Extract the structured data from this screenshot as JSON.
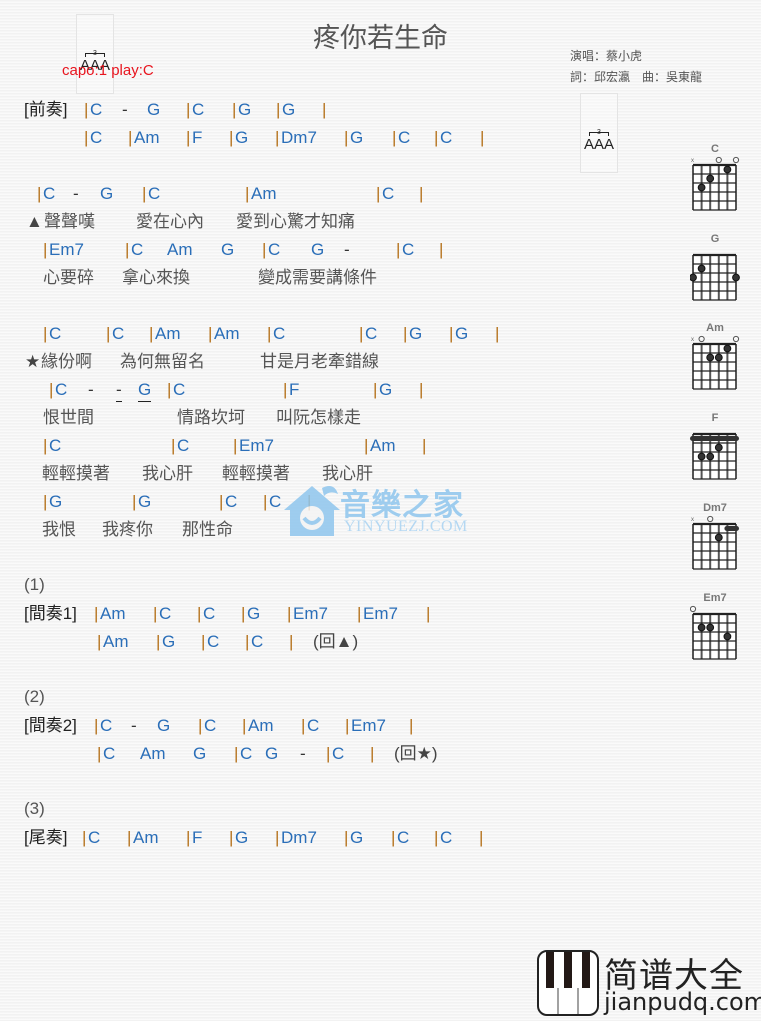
{
  "title": "疼你若生命",
  "triplet_icon": {
    "number": "3",
    "notes": "AAA"
  },
  "capo": "capo:1 play:C",
  "credits": {
    "singer": "演唱：蔡小虎",
    "lyricist_composer": "詞：邱宏瀛　曲：吳東龍"
  },
  "sections": {
    "intro_label": "[前奏]",
    "interlude1_label": "[間奏1]",
    "interlude2_label": "[間奏2]",
    "outro_label": "[尾奏]",
    "part1": "(1)",
    "part2": "(2)",
    "part3": "(3)"
  },
  "lines": {
    "intro_1": [
      "C",
      "-",
      "G",
      "C",
      "G",
      "G"
    ],
    "intro_2": [
      "C",
      "Am",
      "F",
      "G",
      "Dm7",
      "G",
      "C",
      "C"
    ],
    "v1_chords": [
      "C",
      "-",
      "G",
      "C",
      "Am",
      "C"
    ],
    "v1_lyric": {
      "mark": "▲",
      "parts": [
        "聲聲嘆",
        "愛在心內",
        "愛到心驚才知痛"
      ]
    },
    "v2_chords": [
      "Em7",
      "C",
      "Am",
      "G",
      "C",
      "G",
      "-",
      "C"
    ],
    "v2_lyric": {
      "parts": [
        "心要碎",
        "拿心來換",
        "變成需要講條件"
      ]
    },
    "c1_chords": [
      "C",
      "C",
      "Am",
      "Am",
      "C",
      "C",
      "G",
      "G"
    ],
    "c1_lyric": {
      "mark": "★",
      "parts": [
        "緣份啊",
        "為何無留名",
        "甘是月老牽錯線"
      ]
    },
    "c2_chords": [
      "C",
      "-",
      "-",
      "G",
      "C",
      "F",
      "G"
    ],
    "c2_lyric": {
      "parts": [
        "恨世間",
        "情路坎坷",
        "叫阮怎樣走"
      ]
    },
    "c3_chords": [
      "C",
      "C",
      "Em7",
      "Am"
    ],
    "c3_lyric": {
      "parts": [
        "輕輕摸著",
        "我心肝",
        "輕輕摸著",
        "我心肝"
      ]
    },
    "c4_chords": [
      "G",
      "G",
      "C",
      "C"
    ],
    "c4_lyric": {
      "parts": [
        "我恨",
        "我疼你",
        "那性命"
      ]
    },
    "i1_1": [
      "Am",
      "C",
      "C",
      "G",
      "Em7",
      "Em7"
    ],
    "i1_2": [
      "Am",
      "G",
      "C",
      "C"
    ],
    "i1_return": "(回▲)",
    "i2_1": [
      "C",
      "-",
      "G",
      "C",
      "Am",
      "C",
      "Em7"
    ],
    "i2_2": [
      "C",
      "Am",
      "G",
      "C",
      "G",
      "-",
      "C"
    ],
    "i2_return": "(回★)",
    "outro": [
      "C",
      "Am",
      "F",
      "G",
      "Dm7",
      "G",
      "C",
      "C"
    ]
  },
  "chord_diagrams": [
    {
      "name": "C"
    },
    {
      "name": "G"
    },
    {
      "name": "Am"
    },
    {
      "name": "F"
    },
    {
      "name": "Dm7"
    },
    {
      "name": "Em7"
    }
  ],
  "watermark": {
    "cn": "音樂之家",
    "en": "YINYUEZJ.COM"
  },
  "logo": {
    "cn": "简谱大全",
    "en": "jianpudq.com"
  },
  "colors": {
    "chord": "#2a6eb8",
    "bar": "#b5721c",
    "capo": "#e8141e"
  }
}
